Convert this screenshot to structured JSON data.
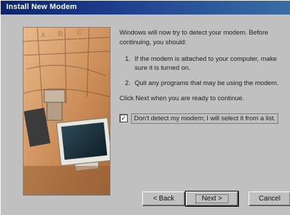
{
  "window": {
    "title": "Install New Modem"
  },
  "body": {
    "intro": "Windows will now try to detect your modem. Before continuing, you should:",
    "steps": [
      {
        "num": "1.",
        "text": "If the modem is attached to your computer, make sure it is turned on."
      },
      {
        "num": "2.",
        "text": "Quit any programs that may be using the modem."
      }
    ],
    "prompt": "Click Next when you are ready to continue.",
    "checkbox": {
      "checked_glyph": "✓",
      "label": "Don't detect my modem; I will select it from a list."
    }
  },
  "buttons": {
    "back": "< Back",
    "next": "Next >",
    "cancel": "Cancel"
  }
}
